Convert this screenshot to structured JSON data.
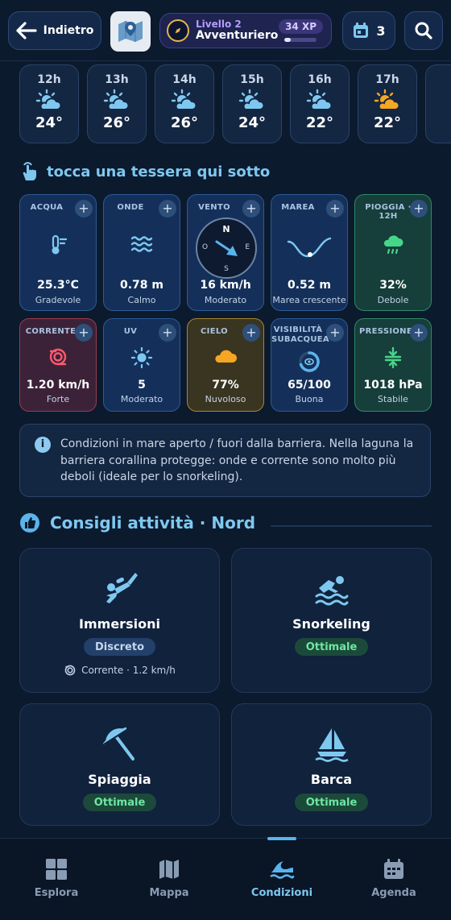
{
  "header": {
    "back_label": "Indietro",
    "level_label": "Livello 2",
    "level_name": "Avventuriero",
    "xp": "34 XP",
    "xp_progress": 0.2,
    "calendar_count": "3"
  },
  "hourly": [
    {
      "time": "12h",
      "temp": "24°",
      "icon": "sun-cloud-icon"
    },
    {
      "time": "13h",
      "temp": "26°",
      "icon": "sun-cloud-icon"
    },
    {
      "time": "14h",
      "temp": "26°",
      "icon": "sun-cloud-icon"
    },
    {
      "time": "15h",
      "temp": "24°",
      "icon": "sun-cloud-icon"
    },
    {
      "time": "16h",
      "temp": "22°",
      "icon": "sun-cloud-icon"
    },
    {
      "time": "17h",
      "temp": "22°",
      "icon": "sun-icon"
    }
  ],
  "hint": "tocca una tessera qui sotto",
  "tiles": {
    "acqua": {
      "label": "ACQUA",
      "value": "25.3°C",
      "desc": "Gradevole"
    },
    "onde": {
      "label": "ONDE",
      "value": "0.78 m",
      "desc": "Calmo"
    },
    "vento": {
      "label": "VENTO",
      "value": "16 km/h",
      "desc": "Moderato",
      "n": "N",
      "e": "E",
      "s": "S",
      "o": "O"
    },
    "marea": {
      "label": "MAREA",
      "value": "0.52 m",
      "desc": "Marea crescente"
    },
    "pioggia": {
      "label": "PIOGGIA · 12H",
      "value": "32%",
      "desc": "Debole"
    },
    "corrente": {
      "label": "CORRENTE",
      "value": "1.20 km/h",
      "desc": "Forte"
    },
    "uv": {
      "label": "UV",
      "value": "5",
      "desc": "Moderato"
    },
    "cielo": {
      "label": "CIELO",
      "value": "77%",
      "desc": "Nuvoloso"
    },
    "visibilita": {
      "label_line1": "VISIBILITÀ",
      "label_line2": "SUBACQUEA",
      "value": "65/100",
      "desc": "Buona"
    },
    "pressione": {
      "label": "PRESSIONE",
      "value": "1018 hPa",
      "desc": "Stabile"
    }
  },
  "info": {
    "text": "Condizioni in mare aperto / fuori dalla barriera. Nella laguna la barriera corallina protegge: onde e corrente sono molto più deboli (ideale per lo snorkeling)."
  },
  "activities": {
    "title": "Consigli attività · Nord",
    "items": [
      {
        "name": "Immersioni",
        "rating": "Discreto",
        "note": "Corrente · 1.2 km/h"
      },
      {
        "name": "Snorkeling",
        "rating": "Ottimale"
      },
      {
        "name": "Spiaggia",
        "rating": "Ottimale"
      },
      {
        "name": "Barca",
        "rating": "Ottimale"
      }
    ]
  },
  "nav": {
    "esplora": "Esplora",
    "mappa": "Mappa",
    "condizioni": "Condizioni",
    "agenda": "Agenda",
    "active": "condizioni"
  },
  "colors": {
    "background": "#0c1a2e",
    "accent": "#7ec8f0",
    "good": "#6ee7a4",
    "sun": "#f5a623"
  }
}
